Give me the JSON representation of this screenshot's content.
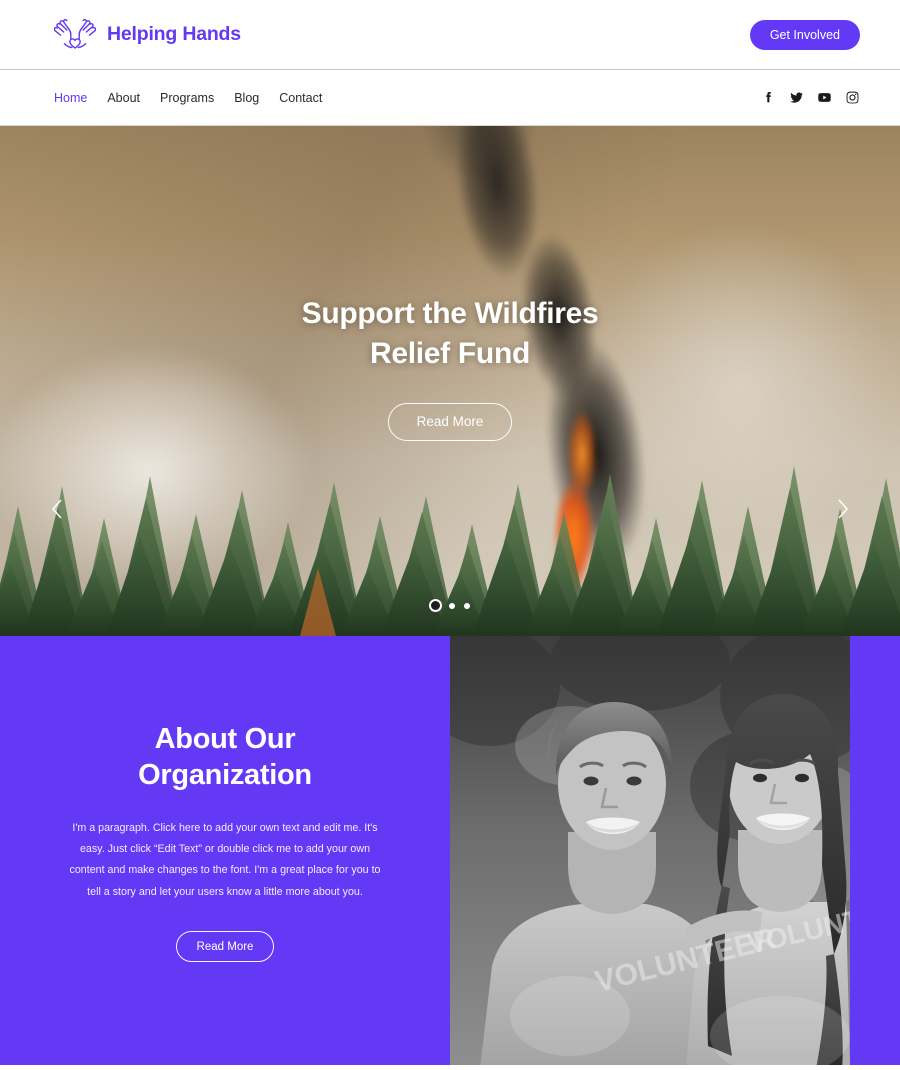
{
  "header": {
    "logo_icon": "hands-heart-icon",
    "brand_name": "Helping Hands",
    "cta_label": "Get Involved",
    "brand_color": "#6439F5"
  },
  "nav": {
    "items": [
      {
        "label": "Home",
        "active": true
      },
      {
        "label": "About",
        "active": false
      },
      {
        "label": "Programs",
        "active": false
      },
      {
        "label": "Blog",
        "active": false
      },
      {
        "label": "Contact",
        "active": false
      }
    ],
    "socials": [
      {
        "name": "facebook-icon",
        "label": "Facebook"
      },
      {
        "name": "twitter-icon",
        "label": "Twitter"
      },
      {
        "name": "youtube-icon",
        "label": "YouTube"
      },
      {
        "name": "instagram-icon",
        "label": "Instagram"
      }
    ]
  },
  "hero": {
    "title_line1": "Support the Wildfires",
    "title_line2": "Relief Fund",
    "button_label": "Read More",
    "prev_label": "Previous slide",
    "next_label": "Next slide",
    "slides_total": 3,
    "active_slide": 1,
    "image_alt": "Wildfire smoke and flames rising behind a pine forest"
  },
  "about": {
    "title_line1": "About Our",
    "title_line2": "Organization",
    "paragraph": "I'm a paragraph. Click here to add your own text and edit me. It's easy. Just click “Edit Text” or double click me to add your own content and make changes to the font. I'm a great place for you to tell a story and let your users know a little more about you.",
    "button_label": "Read More",
    "background_color": "#6439F5",
    "image_alt": "Two smiling women wearing VOLUNTEER t-shirts, black and white photo"
  }
}
